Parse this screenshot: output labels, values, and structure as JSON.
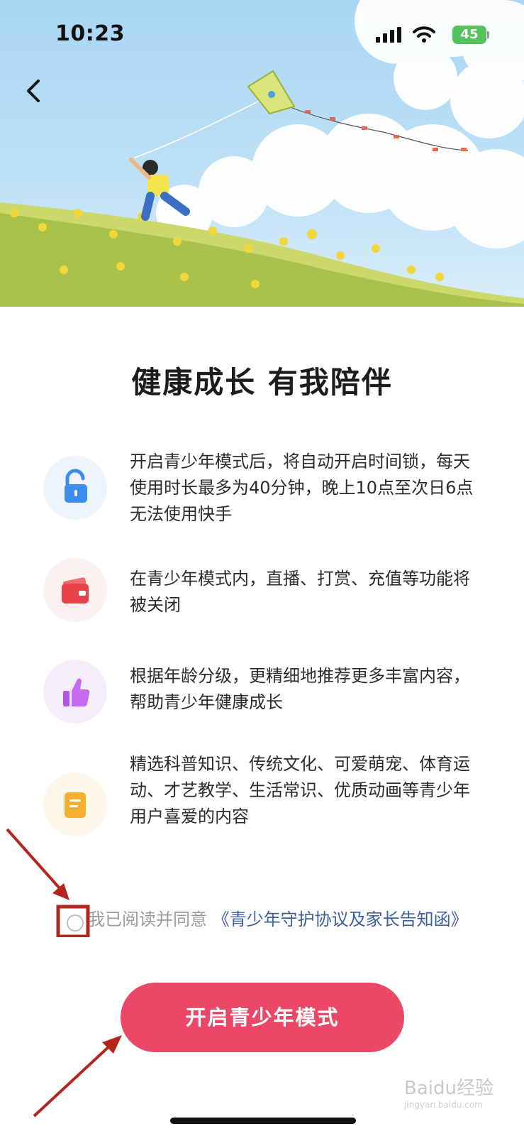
{
  "status_bar": {
    "time": "10:23",
    "battery": "45"
  },
  "headline": "健康成长 有我陪伴",
  "features": [
    {
      "icon": "unlocked-lock-icon",
      "text": "开启青少年模式后，将自动开启时间锁，每天使用时长最多为40分钟，晚上10点至次日6点无法使用快手"
    },
    {
      "icon": "wallet-icon",
      "text": "在青少年模式内，直播、打赏、充值等功能将被关闭"
    },
    {
      "icon": "thumbs-up-icon",
      "text": "根据年龄分级，更精细地推荐更多丰富内容，帮助青少年健康成长"
    },
    {
      "icon": "document-icon",
      "text": "精选科普知识、传统文化、可爱萌宠、体育运动、才艺教学、生活常识、优质动画等青少年用户喜爱的内容"
    }
  ],
  "agreement": {
    "prefix": "我已阅读并同意",
    "link": "《青少年守护协议及家长告知函》"
  },
  "cta_label": "开启青少年模式",
  "watermark": {
    "brand": "Baidu经验",
    "url": "jingyan.baidu.com"
  },
  "colors": {
    "accent": "#ea4866",
    "link": "#3b5fa0",
    "annotation": "#b3261e"
  }
}
